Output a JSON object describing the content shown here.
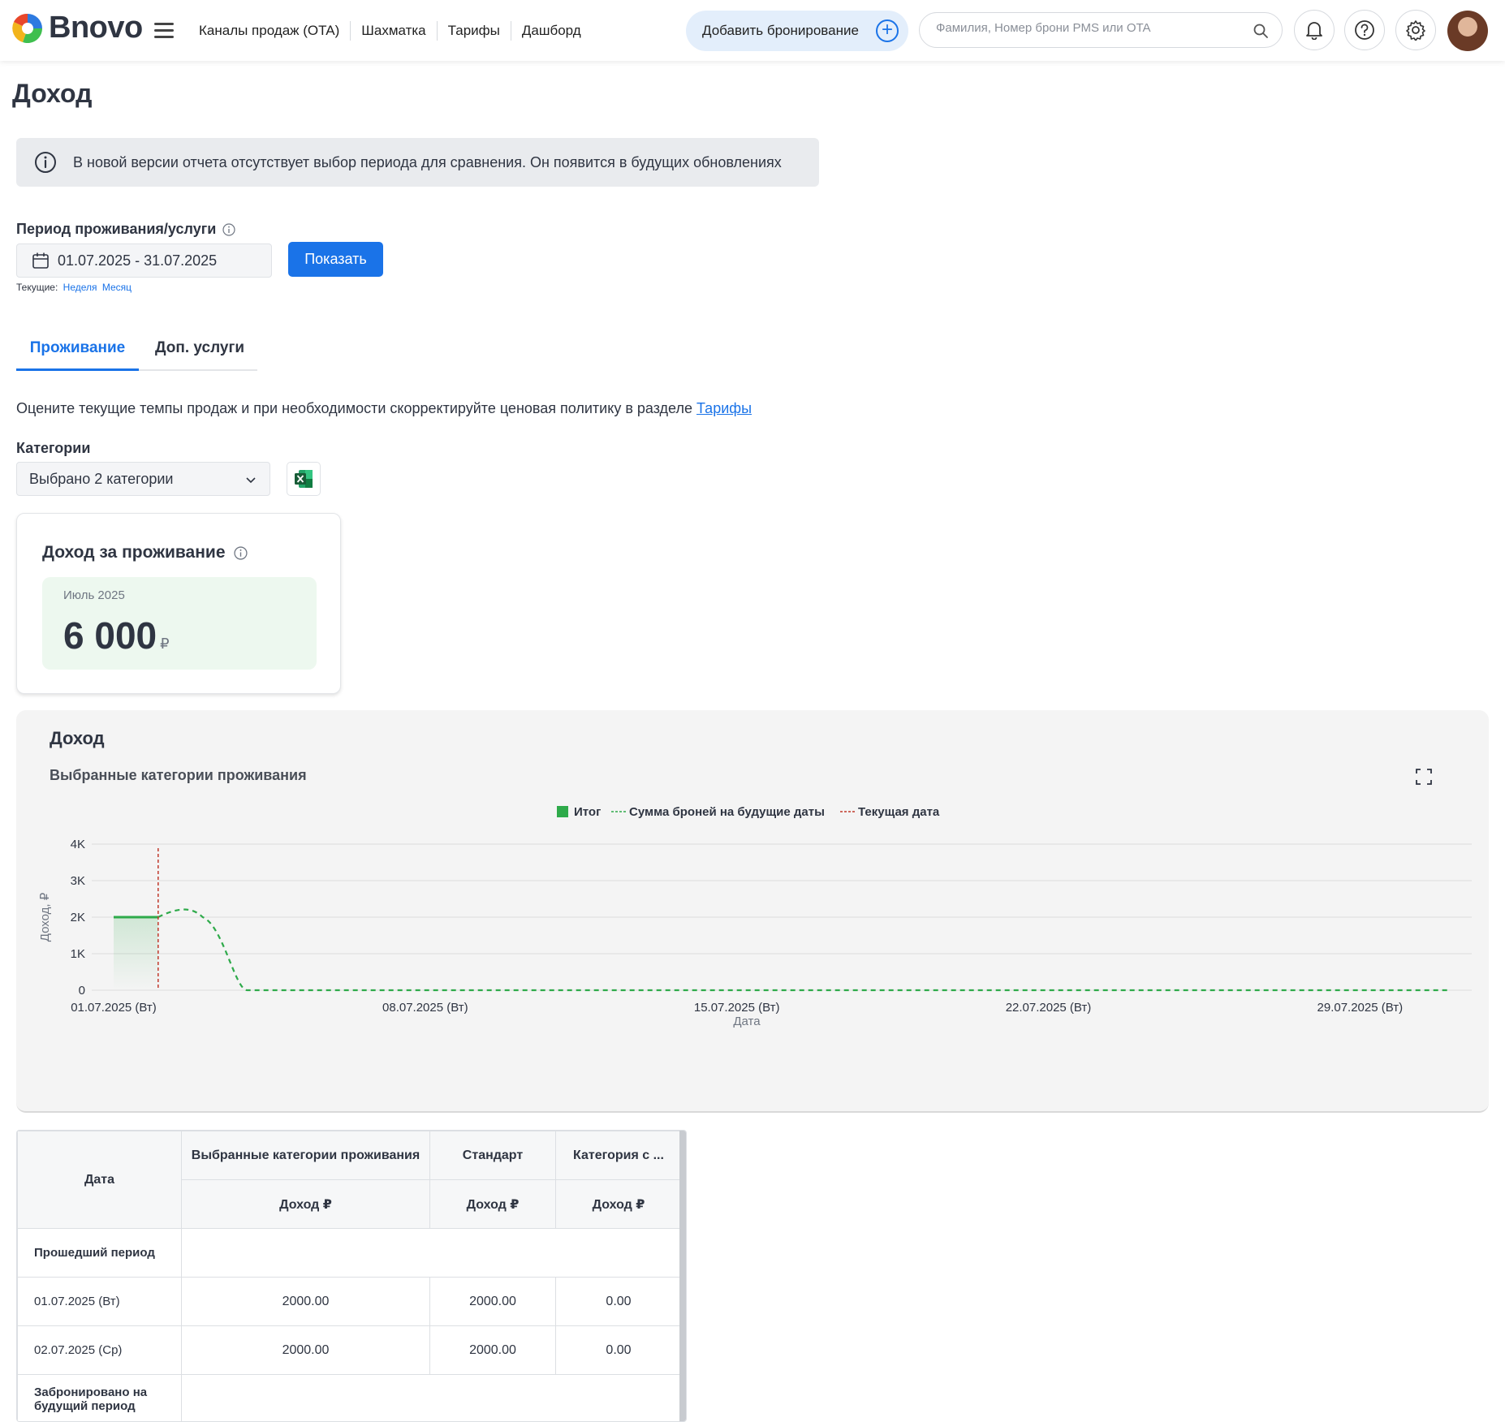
{
  "header": {
    "logo_text": "Bnovo",
    "nav": [
      "Каналы продаж (OTA)",
      "Шахматка",
      "Тарифы",
      "Дашборд"
    ],
    "add_booking_label": "Добавить бронирование",
    "search_placeholder": "Фамилия, Номер брони PMS или OTA"
  },
  "page": {
    "title": "Доход",
    "info_banner": "В новой версии отчета отсутствует выбор периода для сравнения. Он появится в будущих обновлениях",
    "period_label": "Период проживания/услуги",
    "date_range": "01.07.2025 - 31.07.2025",
    "show_button": "Показать",
    "current_prefix": "Текущие:",
    "current_week": "Неделя",
    "current_month": "Месяц",
    "tabs": [
      "Проживание",
      "Доп. услуги"
    ],
    "description": "Оцените текущие темпы продаж и при необходимости скорректируйте ценовая политику в разделе",
    "description_link": "Тарифы",
    "categories_label": "Категории",
    "categories_value": "Выбрано 2 категории"
  },
  "kpi": {
    "title": "Доход за проживание",
    "period": "Июль 2025",
    "value": "6 000",
    "currency": "₽"
  },
  "chart_panel": {
    "title": "Доход",
    "subtitle": "Выбранные категории проживания"
  },
  "chart_data": {
    "type": "line",
    "legend": [
      "Итог",
      "Сумма броней на будущие даты",
      "Текущая дата"
    ],
    "legend_position": "top-center",
    "ylabel": "Доход, ₽",
    "xlabel": "Дата",
    "ylim": [
      0,
      4000
    ],
    "y_ticks": [
      "0",
      "1K",
      "2K",
      "3K",
      "4K"
    ],
    "x_ticks": [
      "01.07.2025 (Вт)",
      "08.07.2025 (Вт)",
      "15.07.2025 (Вт)",
      "22.07.2025 (Вт)",
      "29.07.2025 (Вт)"
    ],
    "grid": true,
    "series": [
      {
        "name": "Итог",
        "x": [
          "01.07.2025",
          "02.07.2025"
        ],
        "values": [
          2000,
          2000
        ],
        "color": "#2eaa4a"
      },
      {
        "name": "Сумма броней на будущие даты",
        "x": [
          "02.07.2025",
          "03.07.2025",
          "04.07.2025",
          "05.07.2025",
          "31.07.2025"
        ],
        "values": [
          2000,
          2000,
          0,
          0,
          0
        ],
        "color": "#2eaa4a"
      }
    ],
    "current_date": "02.07.2025",
    "current_date_color": "#c0392b"
  },
  "table": {
    "header_date": "Дата",
    "groups": [
      "Выбранные категории проживания",
      "Стандарт",
      "Категория с ..."
    ],
    "sub_header": "Доход ₽",
    "rows": [
      {
        "label": "Прошедший период",
        "section": true
      },
      {
        "label": "01.07.2025 (Вт)",
        "values": [
          "2000.00",
          "2000.00",
          "0.00"
        ]
      },
      {
        "label": "02.07.2025 (Ср)",
        "values": [
          "2000.00",
          "2000.00",
          "0.00"
        ]
      },
      {
        "label": "Забронировано на будущий период",
        "section": true
      }
    ]
  }
}
